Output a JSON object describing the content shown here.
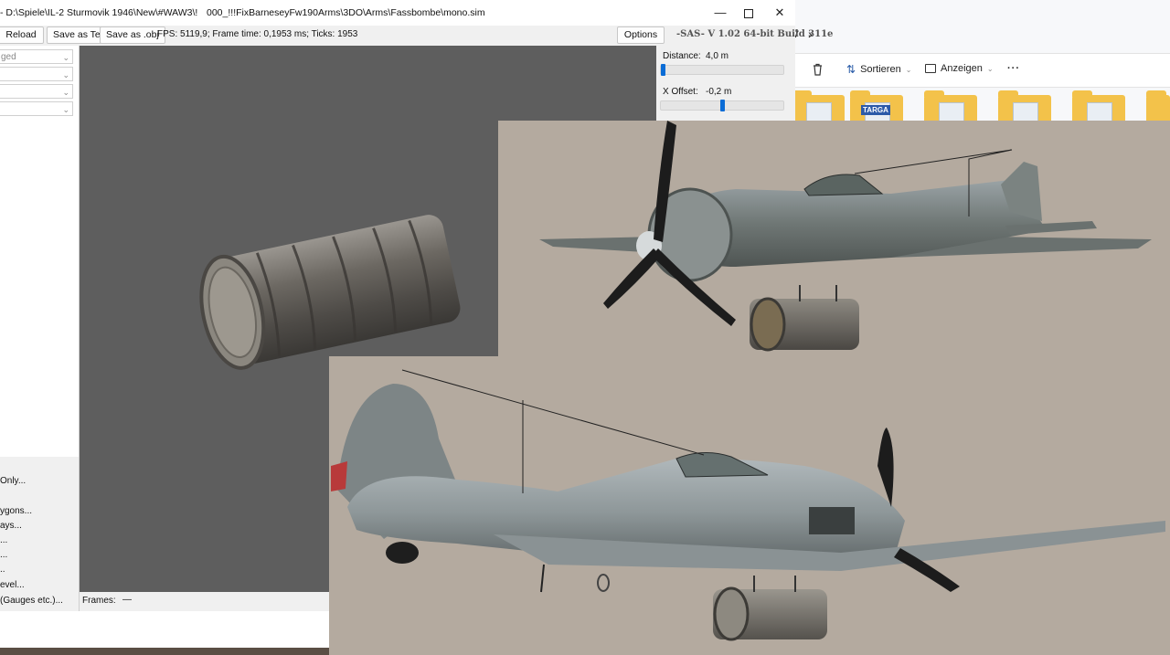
{
  "viewer": {
    "title_path": "- D:\\Spiele\\IL-2 Sturmovik 1946\\New\\#WAW3\\!",
    "title_file": "000_!!!FixBarneseyFw190Arms\\3DO\\Arms\\Fassbombe\\mono.sim",
    "toolbar": {
      "reload": "Reload",
      "save_text": "Save as Text",
      "save_obj": "Save as .obj",
      "stats": "FPS: 5119,9; Frame time: 0,1953 ms; Ticks: 1953",
      "options": "Options",
      "brand": "-SAS- V 1.02  64-bit  Build 311e"
    },
    "left_panel": {
      "combos": [
        "ged",
        "",
        "",
        ""
      ],
      "menu_items": [
        "Only...",
        "ygons...",
        "ays...",
        "...",
        "...",
        "..",
        "evel...",
        "(Gauges etc.)..."
      ]
    },
    "right_panel": {
      "distance_label": "Distance:",
      "distance_value": "4,0 m",
      "distance_level": 0.0,
      "xoffset_label": "X Offset:",
      "xoffset_value": "-0,2 m",
      "xoffset_level": 0.5
    },
    "frames_label": "Frames:",
    "frames_value": "—"
  },
  "explorer": {
    "nav_fragment": "7",
    "forward_icon": "chevron-right-icon",
    "delete_icon": "trash-icon",
    "sort_label": "Sortieren",
    "view_label": "Anzeigen",
    "more_icon": "more-icon",
    "targa_label": "TARGA"
  },
  "colors": {
    "viewport_bg": "#5e5e5e",
    "render_bg": "#b4aa9f",
    "accent": "#0a6cd6"
  }
}
